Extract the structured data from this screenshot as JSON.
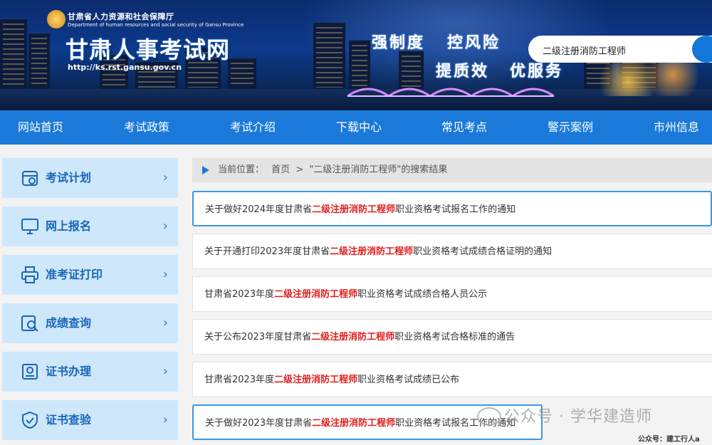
{
  "header": {
    "org_cn": "甘肃省人力资源和社会保障厅",
    "org_en": "Department of human resources and social security of Gansu Province",
    "title": "甘肃人事考试网",
    "url": "http://ks.rst.gansu.gov.cn",
    "slogans": [
      "强制度",
      "控风险",
      "提质效",
      "优服务"
    ],
    "search_value": "二级注册消防工程师"
  },
  "nav": {
    "items": [
      "网站首页",
      "考试政策",
      "考试介绍",
      "下载中心",
      "常见考点",
      "警示案例",
      "市州信息"
    ]
  },
  "sidebar": {
    "items": [
      {
        "label": "考试计划",
        "icon": "calendar-icon"
      },
      {
        "label": "网上报名",
        "icon": "monitor-icon"
      },
      {
        "label": "准考证打印",
        "icon": "printer-icon"
      },
      {
        "label": "成绩查询",
        "icon": "search-doc-icon"
      },
      {
        "label": "证书办理",
        "icon": "certificate-icon"
      },
      {
        "label": "证书查验",
        "icon": "shield-check-icon"
      }
    ],
    "arrow": "›"
  },
  "breadcrumb": {
    "prefix": "当前位置：",
    "home": "首页",
    "separator": ">",
    "current": "\"二级注册消防工程师\"的搜索结果"
  },
  "results": [
    {
      "before": "关于做好2024年度甘肃省",
      "highlight": "二级注册消防工程师",
      "after": "职业资格考试报名工作的通知"
    },
    {
      "before": "关于开通打印2023年度甘肃省",
      "highlight": "二级注册消防工程师",
      "after": "职业资格考试成绩合格证明的通知"
    },
    {
      "before": "甘肃省2023年度",
      "highlight": "二级注册消防工程师",
      "after": "职业资格考试成绩合格人员公示"
    },
    {
      "before": "关于公布2023年度甘肃省",
      "highlight": "二级注册消防工程师",
      "after": "职业资格考试合格标准的通告"
    },
    {
      "before": "甘肃省2023年度",
      "highlight": "二级注册消防工程师",
      "after": "职业资格考试成绩已公布"
    },
    {
      "before": "关于做好2023年度甘肃省",
      "highlight": "二级注册消防工程师",
      "after": "职业资格考试报名工作的通知"
    }
  ],
  "watermark": "公众号 · 学华建造师",
  "footer_note": "公众号：建工行人a",
  "colors": {
    "nav": "#1b7ad9",
    "highlight": "#e11d1d",
    "sidebar_bg": "#cfe7fb",
    "box": "#3a98e6"
  }
}
